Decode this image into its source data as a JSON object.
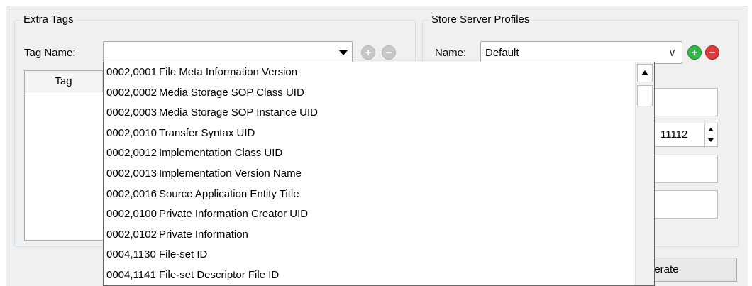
{
  "extra_tags": {
    "title": "Extra Tags",
    "tag_name_label": "Tag Name:",
    "tag_name_value": "",
    "table_header_tag": "Tag"
  },
  "store_server": {
    "title": "Store Server Profiles",
    "name_label": "Name:",
    "name_value": "Default",
    "port_value": "11112",
    "generate_label": "nerate"
  },
  "dropdown": {
    "items": [
      {
        "code": "0002,0001",
        "name": "File Meta Information Version"
      },
      {
        "code": "0002,0002",
        "name": "Media Storage SOP Class UID"
      },
      {
        "code": "0002,0003",
        "name": "Media Storage SOP Instance UID"
      },
      {
        "code": "0002,0010",
        "name": "Transfer Syntax UID"
      },
      {
        "code": "0002,0012",
        "name": "Implementation Class UID"
      },
      {
        "code": "0002,0013",
        "name": "Implementation Version Name"
      },
      {
        "code": "0002,0016",
        "name": "Source Application Entity Title"
      },
      {
        "code": "0002,0100",
        "name": "Private Information Creator UID"
      },
      {
        "code": "0002,0102",
        "name": "Private Information"
      },
      {
        "code": "0004,1130",
        "name": "File-set ID"
      },
      {
        "code": "0004,1141",
        "name": "File-set Descriptor File ID"
      }
    ]
  },
  "colors": {
    "add": "#33b84a",
    "remove": "#e23b3b",
    "disabled": "#c8c8c8"
  }
}
